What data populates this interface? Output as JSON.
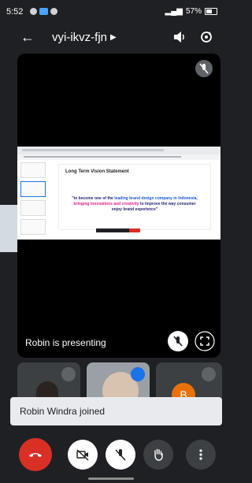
{
  "status_bar": {
    "time": "5:52",
    "battery": "57%"
  },
  "toolbar": {
    "meeting_code": "vyi-ikvz-fjn"
  },
  "slide": {
    "title": "Long Term Vision Statement",
    "quote_part1": "\"to become one of the ",
    "quote_hl1": "leading brand design company in Indonesia",
    "quote_part2": ", ",
    "quote_hl2": "bringing innovations and creativity",
    "quote_part3": " to improve the way consumer enjoy brand experience\""
  },
  "stage": {
    "presenting_label": "Robin is presenting"
  },
  "tiles": {
    "third_avatar_initial": "B"
  },
  "toast": {
    "message": "Robin Windra joined"
  },
  "colors": {
    "end_call": "#d93025",
    "accent": "#1a73e8",
    "avatar_orange": "#e8710a"
  },
  "icons": {
    "back": "arrow-left-icon",
    "speaker": "speaker-icon",
    "rotate_camera": "camera-switch-icon",
    "mic_off": "mic-off-icon",
    "fullscreen": "fullscreen-icon",
    "end_call": "phone-hangup-icon",
    "camera_off": "camera-off-icon",
    "raise_hand": "hand-icon",
    "more": "more-vert-icon"
  }
}
